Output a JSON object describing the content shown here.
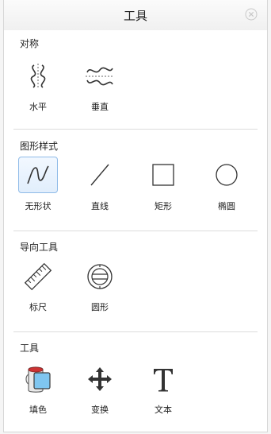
{
  "header": {
    "title": "工具"
  },
  "sections": [
    {
      "title": "对称",
      "tools": [
        {
          "label": "水平",
          "icon": "horizontal-symmetry-icon"
        },
        {
          "label": "垂直",
          "icon": "vertical-symmetry-icon"
        }
      ]
    },
    {
      "title": "图形样式",
      "tools": [
        {
          "label": "无形状",
          "icon": "freeform-curve-icon",
          "selected": true
        },
        {
          "label": "直线",
          "icon": "line-icon"
        },
        {
          "label": "矩形",
          "icon": "rectangle-icon"
        },
        {
          "label": "椭圆",
          "icon": "ellipse-icon"
        }
      ]
    },
    {
      "title": "导向工具",
      "tools": [
        {
          "label": "标尺",
          "icon": "ruler-icon"
        },
        {
          "label": "圆形",
          "icon": "circle-guide-icon"
        }
      ]
    },
    {
      "title": "工具",
      "tools": [
        {
          "label": "填色",
          "icon": "fill-bucket-icon"
        },
        {
          "label": "变换",
          "icon": "move-arrows-icon"
        },
        {
          "label": "文本",
          "icon": "text-icon"
        }
      ]
    }
  ],
  "colors": {
    "selected_border": "#8fbbe8",
    "fill_blue": "#7fc6f0",
    "icon_stroke": "#333333"
  }
}
